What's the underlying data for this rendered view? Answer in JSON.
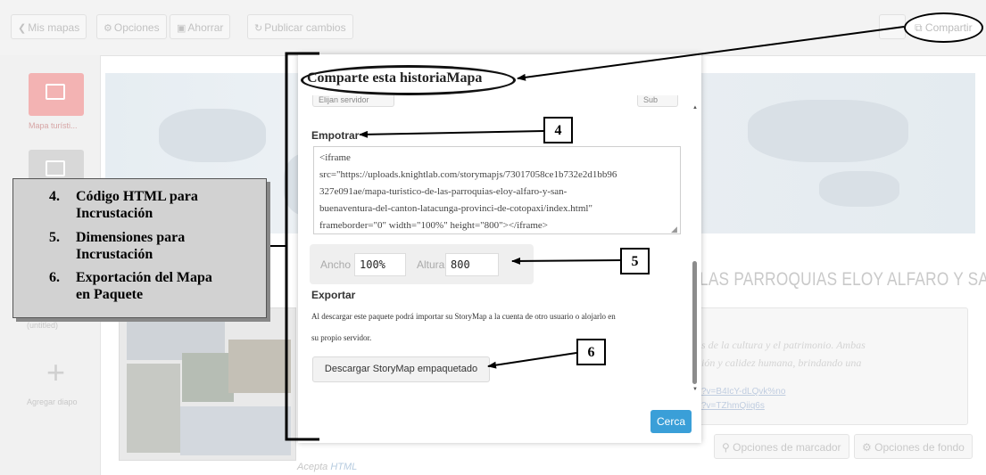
{
  "toolbar": {
    "my_maps": "Mis mapas",
    "options": "Opciones",
    "save": "Ahorrar",
    "publish": "Publicar cambios",
    "share": "Compartir"
  },
  "sidebar": {
    "slide1_label": "Mapa turísti...",
    "slide2_label": "(untitled)",
    "add_slide": "Agregar diapo"
  },
  "background": {
    "story_title": "LAS PARROQUIAS ELOY ALFARO Y SA",
    "text_line1": "s de la cultura y el patrimonio. Ambas",
    "text_line2": "ión y calidez humana, brindando una",
    "link1": "?v=B4IcY-dLQvk%no",
    "link2": "?v=TZhmQiiq6s",
    "marker_options": "Opciones de marcador",
    "background_options": "Opciones de fondo",
    "accepts_label": "Acepta",
    "accepts_html": "HTML"
  },
  "modal": {
    "title": "Comparte esta historiaMapa",
    "top_button_left": "Elijan servidor",
    "top_button_right": "Sub",
    "embed_section": "Empotrar",
    "embed_code": [
      "<iframe",
      "src=\"https://uploads.knightlab.com/storymapjs/73017058ce1b732e2d1bb96",
      "327e091ae/mapa-turistico-de-las-parroquias-eloy-alfaro-y-san-",
      "buenaventura-del-canton-latacunga-provinci-de-cotopaxi/index.html\"",
      "frameborder=\"0\" width=\"100%\" height=\"800\"></iframe>"
    ],
    "width_label": "Ancho",
    "width_value": "100%",
    "height_label": "Altura",
    "height_value": "800",
    "export_section": "Exportar",
    "export_text_line1": "Al descargar este paquete podrá importar su StoryMap a la cuenta de otro usuario o alojarlo en",
    "export_text_line2": "su propio servidor.",
    "download_button": "Descargar StoryMap empaquetado",
    "close_button": "Cerca"
  },
  "annotations": {
    "box4": "4",
    "box5": "5",
    "box6": "6",
    "legend": [
      {
        "num": "4.",
        "line1": "Código HTML para",
        "line2": "Incrustación"
      },
      {
        "num": "5.",
        "line1": "Dimensiones para",
        "line2": "Incrustación"
      },
      {
        "num": "6.",
        "line1": "Exportación del Mapa",
        "line2": "en Paquete"
      }
    ]
  },
  "colors": {
    "primary_button": "#3a9fd8",
    "annotation": "#000000",
    "legend_bg": "#d2d2d2"
  }
}
